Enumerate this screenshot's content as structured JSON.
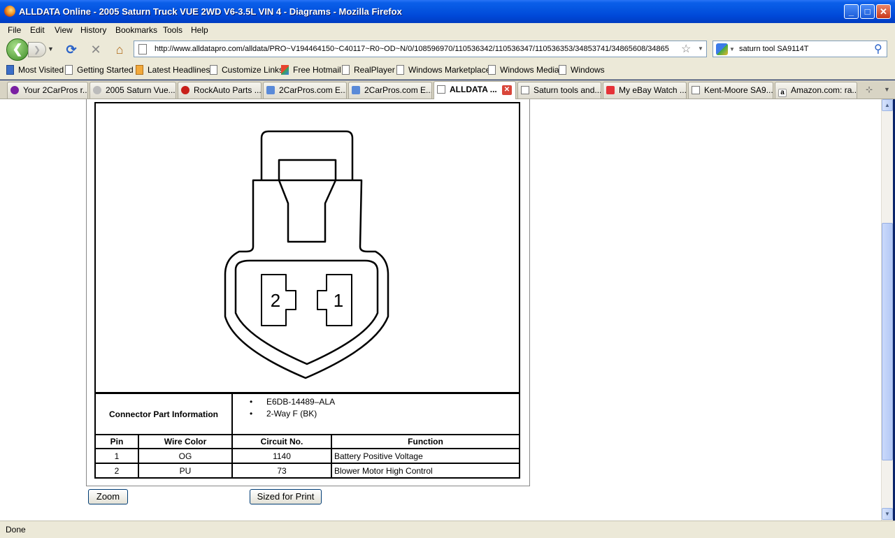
{
  "window": {
    "title": "ALLDATA Online - 2005 Saturn Truck VUE 2WD V6-3.5L VIN 4 - Diagrams - Mozilla Firefox"
  },
  "menu": [
    "File",
    "Edit",
    "View",
    "History",
    "Bookmarks",
    "Tools",
    "Help"
  ],
  "nav": {
    "url": "http://www.alldatapro.com/alldata/PRO~V194464150~C40117~R0~OD~N/0/108596970/110536342/110536347/110536353/34853741/34865608/34865",
    "search_value": "saturn tool SA9114T"
  },
  "bookmarks": [
    "Most Visited",
    "Getting Started",
    "Latest Headlines",
    "Customize Links",
    "Free Hotmail",
    "RealPlayer",
    "Windows Marketplace",
    "Windows Media",
    "Windows"
  ],
  "tabs": [
    "Your 2CarPros r...",
    "2005 Saturn Vue...",
    "RockAuto Parts ...",
    "2CarPros.com E...",
    "2CarPros.com E...",
    "ALLDATA ...",
    "Saturn tools and...",
    "My eBay Watch ...",
    "Kent-Moore SA9...",
    "Amazon.com: ra..."
  ],
  "diagram": {
    "pin_labels": [
      "2",
      "1"
    ]
  },
  "connector": {
    "label": "Connector Part Information",
    "info": [
      "E6DB-14489–ALA",
      "2-Way F (BK)"
    ]
  },
  "table": {
    "headers": [
      "Pin",
      "Wire Color",
      "Circuit No.",
      "Function"
    ],
    "rows": [
      [
        "1",
        "OG",
        "1140",
        "Battery Positive Voltage"
      ],
      [
        "2",
        "PU",
        "73",
        "Blower Motor High Control"
      ]
    ]
  },
  "buttons": {
    "zoom": "Zoom",
    "print": "Sized for Print"
  },
  "status": "Done"
}
